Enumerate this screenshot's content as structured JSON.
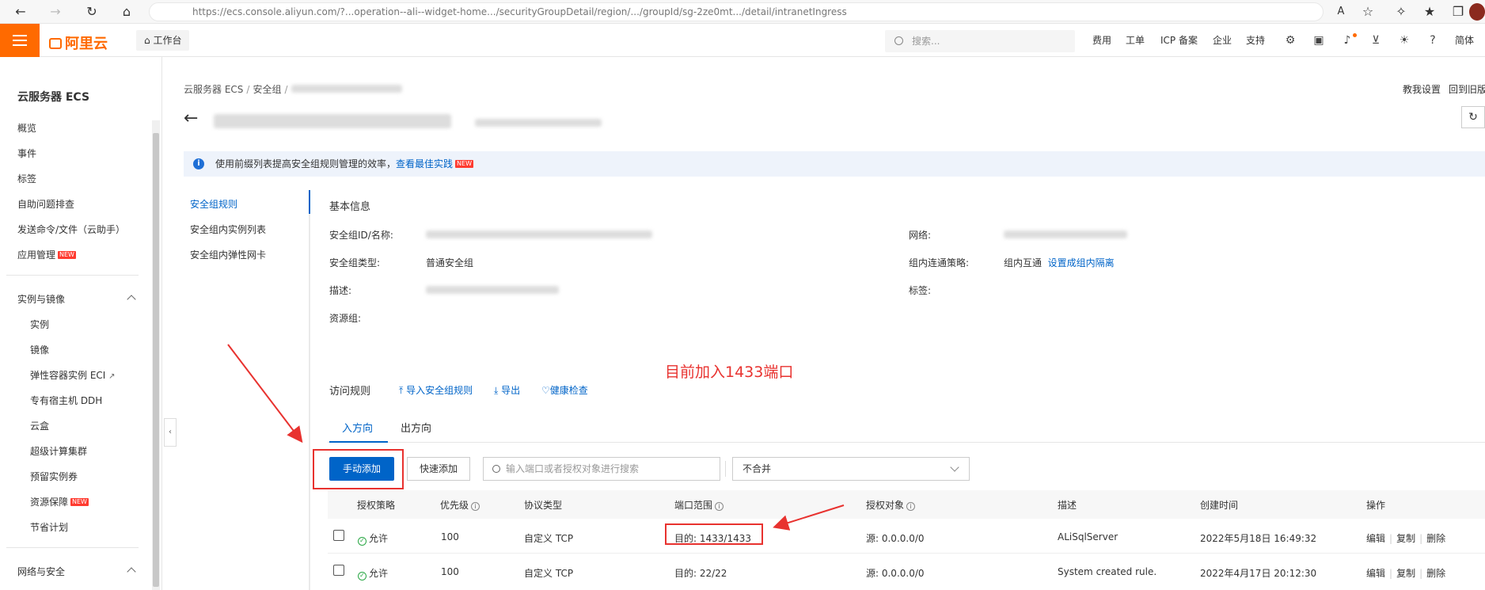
{
  "browser": {
    "url": "https://ecs.console.aliyun.com/?...operation--ali--widget-home.../securityGroupDetail/region/.../groupId/sg-2ze0mt.../detail/intranetIngress"
  },
  "topnav": {
    "brand": "阿里云",
    "workbench": "工作台",
    "search_placeholder": "搜索...",
    "menu": [
      "费用",
      "工单",
      "ICP 备案",
      "企业",
      "支持"
    ],
    "lang": "简体"
  },
  "sidebar": {
    "title": "云服务器 ECS",
    "items": [
      "概览",
      "事件",
      "标签",
      "自助问题排查",
      "发送命令/文件（云助手）",
      "应用管理"
    ],
    "group1": {
      "label": "实例与镜像",
      "items": [
        "实例",
        "镜像",
        "弹性容器实例 ECI",
        "专有宿主机 DDH",
        "云盒",
        "超级计算集群",
        "预留实例券",
        "资源保障",
        "节省计划"
      ]
    },
    "group2": {
      "label": "网络与安全"
    },
    "new_badge": "NEW"
  },
  "header": {
    "breadcrumb": [
      "云服务器 ECS",
      "安全组"
    ],
    "tutorial": "教我设置",
    "back_old": "回到旧版"
  },
  "notice": {
    "text": "使用前缀列表提高安全组规则管理的效率，",
    "link": "查看最佳实践"
  },
  "subnav": [
    "安全组规则",
    "安全组内实例列表",
    "安全组内弹性网卡"
  ],
  "basic_info": {
    "title": "基本信息",
    "labels": {
      "id_name": "安全组ID/名称:",
      "type": "安全组类型:",
      "desc": "描述:",
      "resource_group": "资源组:",
      "network": "网络:",
      "intra_policy": "组内连通策略:",
      "tags": "标签:"
    },
    "type_value": "普通安全组",
    "intra_value": "组内互通",
    "intra_link": "设置成组内隔离"
  },
  "rules": {
    "title": "访问规则",
    "import": "导入安全组规则",
    "export": "导出",
    "health": "健康检查",
    "annotation": "目前加入1433端口",
    "tabs": [
      "入方向",
      "出方向"
    ],
    "add_manual": "手动添加",
    "add_quick": "快速添加",
    "filter_placeholder": "输入端口或者授权对象进行搜索",
    "merge_select": "不合并",
    "columns": [
      "授权策略",
      "优先级",
      "协议类型",
      "端口范围",
      "授权对象",
      "描述",
      "创建时间",
      "操作"
    ],
    "rows": [
      {
        "policy": "允许",
        "priority": "100",
        "protocol": "自定义 TCP",
        "port": "目的: 1433/1433",
        "source": "源: 0.0.0.0/0",
        "desc": "ALiSqlServer",
        "time": "2022年5月18日 16:49:32"
      },
      {
        "policy": "允许",
        "priority": "100",
        "protocol": "自定义 TCP",
        "port": "目的: 22/22",
        "source": "源: 0.0.0.0/0",
        "desc": "System created rule.",
        "time": "2022年4月17日 20:12:30"
      }
    ],
    "ops": [
      "编辑",
      "复制",
      "删除"
    ]
  },
  "colors": {
    "brand": "#ff6a00",
    "primary": "#0064c8",
    "annotation": "#e8322f",
    "allow": "#2aa745"
  }
}
